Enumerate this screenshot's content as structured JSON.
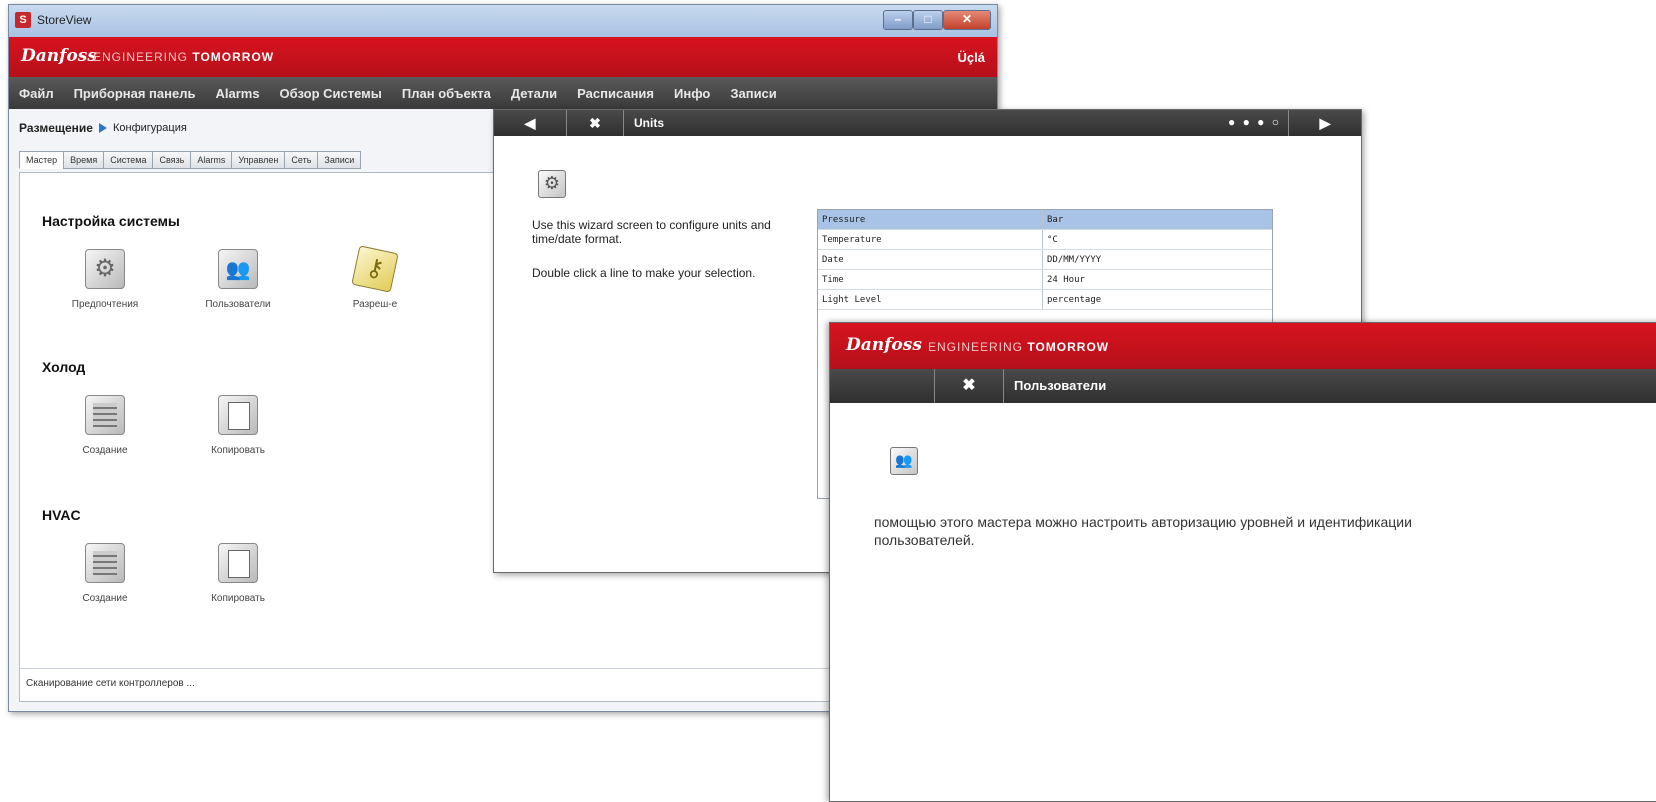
{
  "main_window": {
    "title": "StoreView",
    "brand": {
      "logo": "Danfoss",
      "tagline_light": "ENGINEERING",
      "tagline_bold": "TOMORROW"
    },
    "user": "Üçlá",
    "menu": [
      "Файл",
      "Приборная панель",
      "Alarms",
      "Обзор Системы",
      "План объекта",
      "Детали",
      "Расписания",
      "Инфо",
      "Записи"
    ],
    "breadcrumb": [
      "Размещение",
      "Конфигурация"
    ],
    "tabs": [
      "Мастер",
      "Время",
      "Система",
      "Связь",
      "Alarms",
      "Управлен",
      "Сеть",
      "Записи"
    ],
    "active_tab": "Мастер",
    "sections": [
      {
        "title": "Настройка системы",
        "items": [
          {
            "label": "Предпочтения",
            "icon": "gear-icon"
          },
          {
            "label": "Пользователи",
            "icon": "users-icon"
          },
          {
            "label": "Разреш-е",
            "icon": "key-icon"
          }
        ]
      },
      {
        "title": "Холод",
        "items": [
          {
            "label": "Создание",
            "icon": "refrigeration-create-icon"
          },
          {
            "label": "Копировать",
            "icon": "refrigeration-copy-icon"
          }
        ]
      },
      {
        "title": "HVAC",
        "items": [
          {
            "label": "Создание",
            "icon": "hvac-create-icon"
          },
          {
            "label": "Копировать",
            "icon": "hvac-copy-icon"
          }
        ]
      }
    ],
    "status": "Сканирование сети контроллеров ..."
  },
  "units_wizard": {
    "back": "◀",
    "close": "✖",
    "next": "▶",
    "title": "Units",
    "progress_dots": "● ● ● ○",
    "description_1": "Use this wizard screen to configure units and time/date format.",
    "description_2": "Double click a line to make your selection.",
    "rows": [
      {
        "name": "Pressure",
        "value": "Bar"
      },
      {
        "name": "Temperature",
        "value": "°C"
      },
      {
        "name": "Date",
        "value": "DD/MM/YYYY"
      },
      {
        "name": "Time",
        "value": "24 Hour"
      },
      {
        "name": "Light Level",
        "value": "percentage"
      }
    ],
    "selected_row": 0
  },
  "users_wizard": {
    "brand": {
      "logo": "Danfoss",
      "tagline_light": "ENGINEERING",
      "tagline_bold": "TOMORROW"
    },
    "close": "✖",
    "title": "Пользователи",
    "description": "помощью этого мастера можно настроить авторизацию уровней и идентификации пользователей."
  },
  "colors": {
    "brand_red": "#c8101c",
    "header_dark": "#3a3a3a",
    "selection": "#a9c3e6"
  }
}
